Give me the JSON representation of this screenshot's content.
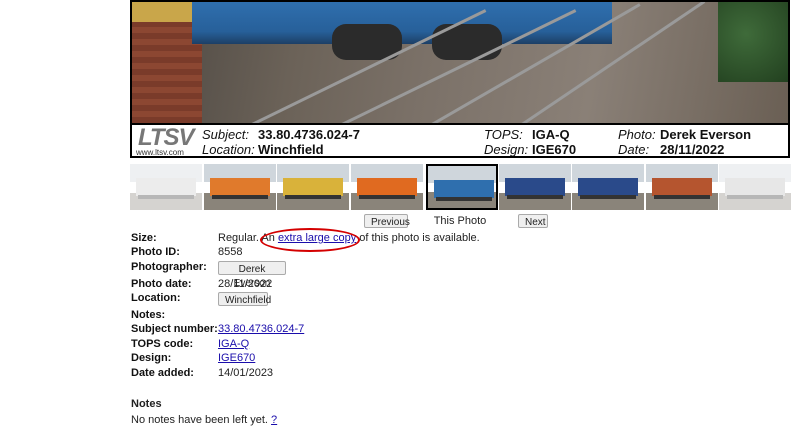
{
  "caption": {
    "logo_text": "LTSV",
    "logo_url": "www.ltsv.com",
    "subject_label": "Subject:",
    "subject_value": "33.80.4736.024-7",
    "location_label": "Location:",
    "location_value": "Winchfield",
    "tops_label": "TOPS:",
    "tops_value": "IGA-Q",
    "design_label": "Design:",
    "design_value": "IGE670",
    "photo_label": "Photo:",
    "photo_value": "Derek Everson",
    "date_label": "Date:",
    "date_value": "28/11/2022"
  },
  "thumbnails": [
    {
      "car_color": "#c9c9c9"
    },
    {
      "car_color": "#e07a2c"
    },
    {
      "car_color": "#d9b23a"
    },
    {
      "car_color": "#e06a20"
    },
    {
      "car_color": "#2f6fae"
    },
    {
      "car_color": "#2a4a8a"
    },
    {
      "car_color": "#2a4a8a"
    },
    {
      "car_color": "#b5552f"
    },
    {
      "car_color": "#bdbdbd"
    }
  ],
  "nav": {
    "previous_label": "Previous",
    "this_photo_label": "This Photo",
    "next_label": "Next"
  },
  "details": {
    "size_label": "Size:",
    "size_prefix": "Regular. An ",
    "size_link": "extra large copy",
    "size_suffix": " of this photo is available.",
    "photo_id_label": "Photo ID:",
    "photo_id_value": "8558",
    "photographer_label": "Photographer:",
    "photographer_value": "Derek Everson",
    "photo_date_label": "Photo date:",
    "photo_date_value": "28/11/2022",
    "location_label": "Location:",
    "location_value": "Winchfield",
    "notes_label": "Notes:",
    "subject_number_label": "Subject number:",
    "subject_number_value": "33.80.4736.024-7",
    "tops_code_label": "TOPS code:",
    "tops_code_value": "IGA-Q",
    "design_label": "Design:",
    "design_value": "IGE670",
    "date_added_label": "Date added:",
    "date_added_value": "14/01/2023"
  },
  "notes": {
    "heading": "Notes",
    "text": "No notes have been left yet.",
    "help_link": "?"
  },
  "colors": {
    "link": "#1a0dab",
    "highlight_circle": "#d40000"
  }
}
